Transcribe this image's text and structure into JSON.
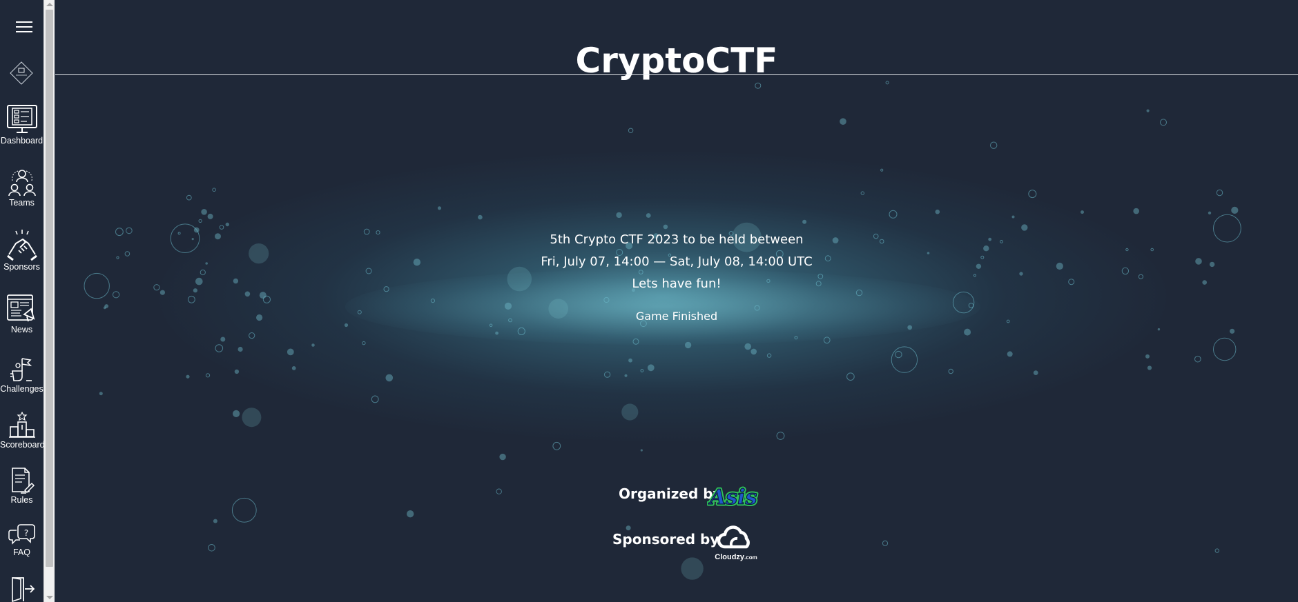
{
  "app": {
    "title": "CryptoCTF"
  },
  "sidebar": {
    "menu_icon": "hamburger-menu-icon",
    "logo_icon": "cryptoctf-logo-icon",
    "items": [
      {
        "label": "Dashboard",
        "icon": "dashboard-icon"
      },
      {
        "label": "Teams",
        "icon": "teams-icon"
      },
      {
        "label": "Sponsors",
        "icon": "sponsors-icon"
      },
      {
        "label": "News",
        "icon": "news-icon"
      },
      {
        "label": "Challenges",
        "icon": "challenges-icon"
      },
      {
        "label": "Scoreboard",
        "icon": "scoreboard-icon"
      },
      {
        "label": "Rules",
        "icon": "rules-icon"
      },
      {
        "label": "FAQ",
        "icon": "faq-icon"
      },
      {
        "label": "",
        "icon": "logout-icon"
      }
    ]
  },
  "event": {
    "line1": "5th Crypto CTF 2023 to be held between",
    "line2": "Fri, July 07, 14:00 — Sat, July 08, 14:00 UTC",
    "line3": "Lets have fun!",
    "status": "Game Finished"
  },
  "footer": {
    "organized_label": "Organized by",
    "organizer_logo_text": "Asis",
    "sponsored_label": "Sponsored by",
    "sponsor_name": "Cloudzy",
    "sponsor_suffix": ".com"
  },
  "colors": {
    "background": "#1f2838",
    "glow": "#5ca8ba",
    "asis_blue": "#1f59c9",
    "asis_green": "#2fc35b"
  }
}
